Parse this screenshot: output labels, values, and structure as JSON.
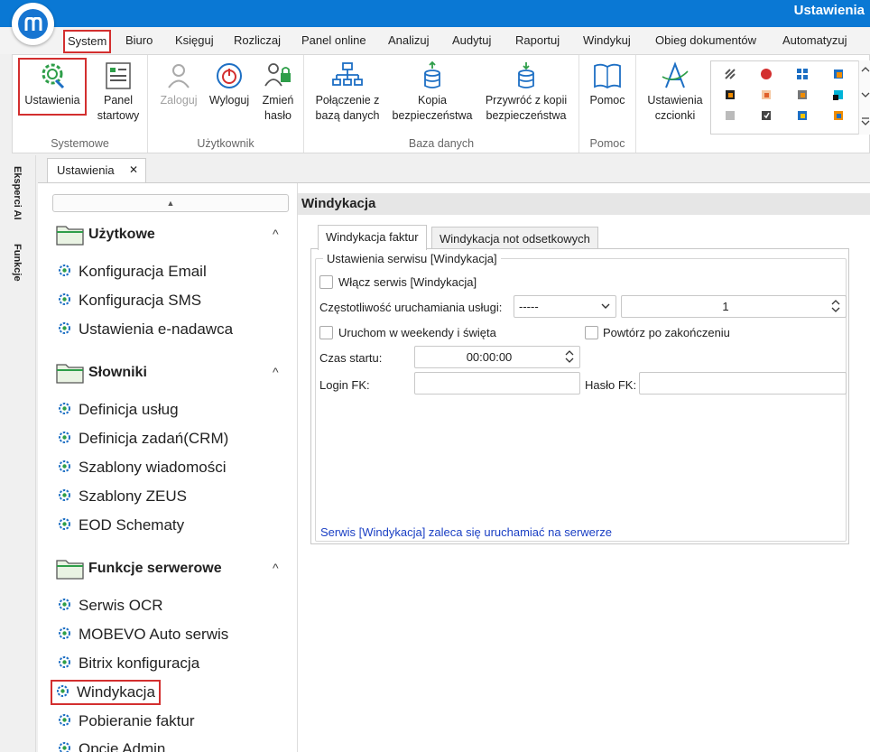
{
  "window": {
    "title": "Ustawienia"
  },
  "menu": {
    "tabs": [
      "System",
      "Biuro",
      "Księguj",
      "Rozliczaj",
      "Panel online",
      "Analizuj",
      "Audytuj",
      "Raportuj",
      "Windykuj",
      "Obieg dokumentów",
      "Automatyzuj"
    ],
    "active": "System"
  },
  "ribbon": {
    "buttons": {
      "ustawienia": "Ustawienia",
      "panel_startowy": [
        "Panel",
        "startowy"
      ],
      "zaloguj": "Zaloguj",
      "wyloguj": "Wyloguj",
      "zmien_haslo": [
        "Zmień",
        "hasło"
      ],
      "polaczenie": [
        "Połączenie z",
        "bazą danych"
      ],
      "kopia": [
        "Kopia",
        "bezpieczeństwa"
      ],
      "przywroc": [
        "Przywróć z kopii",
        "bezpieczeństwa"
      ],
      "pomoc": "Pomoc",
      "ustawienia_czcionki": [
        "Ustawienia",
        "czcionki"
      ]
    },
    "groups": {
      "systemowe": "Systemowe",
      "uzytkownik": "Użytkownik",
      "baza_danych": "Baza danych",
      "pomoc": "Pomoc"
    }
  },
  "side_strip": {
    "eksperci": "Eksperci AI",
    "funkcje": "Funkcje"
  },
  "doc_tab": {
    "label": "Ustawienia",
    "close": "✕"
  },
  "nav": {
    "up": "▲",
    "sections": [
      {
        "title": "Użytkowe",
        "items": [
          "Konfiguracja Email",
          "Konfiguracja SMS",
          "Ustawienia e-nadawca"
        ]
      },
      {
        "title": "Słowniki",
        "items": [
          "Definicja usług",
          "Definicja zadań(CRM)",
          "Szablony wiadomości",
          "Szablony ZEUS",
          "EOD Schematy"
        ]
      },
      {
        "title": "Funkcje serwerowe",
        "items": [
          "Serwis OCR",
          "MOBEVO Auto serwis",
          "Bitrix konfiguracja",
          "Windykacja",
          "Pobieranie faktur",
          "Opcje Admin"
        ]
      }
    ],
    "caret": "^"
  },
  "panel": {
    "title": "Windykacja",
    "tabs": [
      "Windykacja faktur",
      "Windykacja not odsetkowych"
    ],
    "group_title": "Ustawienia serwisu [Windykacja]",
    "enable_label": "Włącz serwis [Windykacja]",
    "frequency_label": "Częstotliwość uruchamiania usługi:",
    "frequency_value": "-----",
    "frequency_count": "1",
    "weekend_label": "Uruchom w weekendy i święta",
    "repeat_label": "Powtórz po zakończeniu",
    "start_label": "Czas startu:",
    "start_value": "00:00:00",
    "login_label": "Login FK:",
    "login_value": "",
    "password_label": "Hasło FK:",
    "password_value": "",
    "note": "Serwis [Windykacja] zaleca się uruchamiać na serwerze"
  },
  "colors": {
    "accent": "#0a78d4",
    "highlight": "#d32f2f",
    "note": "#1a3fc4"
  }
}
